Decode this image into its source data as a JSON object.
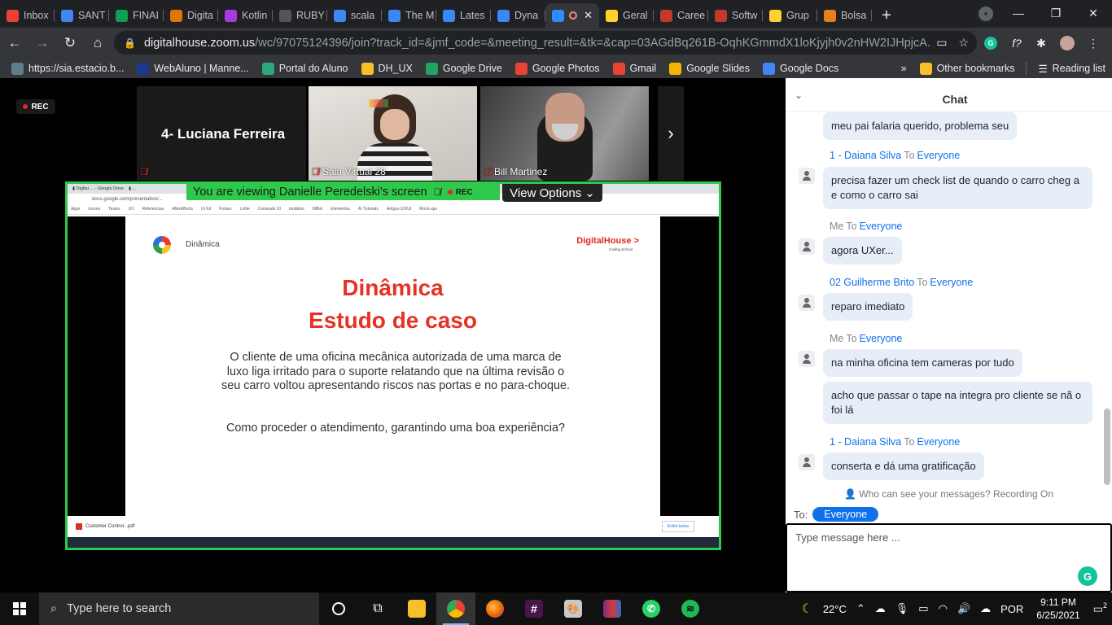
{
  "browser": {
    "tabs": [
      {
        "label": "Inbox",
        "icon": "gmail-icon",
        "color": "#ea4335"
      },
      {
        "label": "SANT",
        "icon": "docs-icon",
        "color": "#4285f4"
      },
      {
        "label": "FINAI",
        "icon": "sheets-icon",
        "color": "#0f9d58"
      },
      {
        "label": "Digita",
        "icon": "app-icon",
        "color": "#e37400"
      },
      {
        "label": "Kotlin",
        "icon": "kotlin-icon",
        "color": "#a83be0"
      },
      {
        "label": "RUBY",
        "icon": "ruby-icon",
        "color": "#555555"
      },
      {
        "label": "scala",
        "icon": "docs-icon",
        "color": "#4285f4"
      },
      {
        "label": "The M",
        "icon": "webflow-icon",
        "color": "#3b88f5"
      },
      {
        "label": "Lates",
        "icon": "webflow-icon",
        "color": "#3b88f5"
      },
      {
        "label": "Dyna",
        "icon": "webflow-icon",
        "color": "#3b88f5"
      },
      {
        "label": "",
        "icon": "zoom-icon",
        "color": "#2d8cff"
      },
      {
        "label": "Geral",
        "icon": "miro-icon",
        "color": "#ffd02f"
      },
      {
        "label": "Caree",
        "icon": "stack-icon",
        "color": "#c0392b"
      },
      {
        "label": "Softw",
        "icon": "stack-icon",
        "color": "#c0392b"
      },
      {
        "label": "Grup",
        "icon": "miro-icon",
        "color": "#ffd02f"
      },
      {
        "label": "Bolsa",
        "icon": "app-icon",
        "color": "#e67e22"
      }
    ],
    "url_host": "digitalhouse.zoom.us",
    "url_path": "/wc/97075124396/join?track_id=&jmf_code=&meeting_result=&tk=&cap=03AGdBq261B-OqhKGmmdX1loKjyjh0v2nHW2IJHpjcA...",
    "bookmarks": [
      {
        "label": "https://sia.estacio.b...",
        "color": "#607d8b"
      },
      {
        "label": "WebAluno | Manne...",
        "color": "#1a3a8f"
      },
      {
        "label": "Portal do Aluno",
        "color": "#2ea67a"
      },
      {
        "label": "DH_UX",
        "color": "#f6c02b"
      },
      {
        "label": "Google Drive",
        "color": "#1fa463"
      },
      {
        "label": "Google Photos",
        "color": "#ea4335"
      },
      {
        "label": "Gmail",
        "color": "#ea4335"
      },
      {
        "label": "Google Slides",
        "color": "#f4b400"
      },
      {
        "label": "Google Docs",
        "color": "#4285f4"
      }
    ],
    "other_bookmarks": "Other bookmarks",
    "reading_list": "Reading list",
    "overflow": "»"
  },
  "meeting": {
    "rec_label": "REC",
    "tiles": [
      {
        "name": "4- Luciana Ferreira"
      },
      {
        "name": "Sala Virtual 28"
      },
      {
        "name": "Bill Martinez"
      }
    ],
    "share_banner": "You are viewing Danielle Peredelski's screen",
    "view_options": "View Options"
  },
  "slide": {
    "header_small": "Dinâmica",
    "brand": "DigitalHouse >",
    "brand_sub": "Coding School",
    "title_line1": "Dinâmica",
    "title_line2": "Estudo de caso",
    "body": "O cliente de uma oficina mecânica autorizada de uma marca de luxo liga irritado para o suporte relatando que na última revisão o seu carro voltou apresentando riscos nas portas e no para-choque.",
    "question": "Como proceder o atendimento, garantindo uma boa experiência?",
    "inner_download": "Customer Control...pdf",
    "inner_download_btn": "Exibir todos"
  },
  "chat": {
    "title": "Chat",
    "messages": [
      {
        "sender": "",
        "to": "",
        "recipient": "",
        "text": "meu pai falaria querido, problema seu"
      },
      {
        "sender": "1 - Daiana Silva",
        "to": "To",
        "recipient": "Everyone",
        "text": "precisa fazer um check list de quando o carro cheg a e como o carro sai"
      },
      {
        "sender": "Me",
        "to": "To",
        "recipient": "Everyone",
        "text": "agora UXer..."
      },
      {
        "sender": "02 Guilherme Brito",
        "to": "To",
        "recipient": "Everyone",
        "text": "reparo imediato"
      },
      {
        "sender": "Me",
        "to": "To",
        "recipient": "Everyone",
        "text": "na minha oficina tem cameras por tudo"
      },
      {
        "sender": "",
        "to": "",
        "recipient": "",
        "text": "acho que passar o tape na integra pro cliente se nã o foi lá"
      },
      {
        "sender": "1 - Daiana Silva",
        "to": "To",
        "recipient": "Everyone",
        "text": "conserta e dá uma gratificação"
      }
    ],
    "who_can_see": "Who can see your messages? Recording On",
    "to_label": "To:",
    "to_value": "Everyone",
    "input_placeholder": "Type message here ..."
  },
  "taskbar": {
    "search_placeholder": "Type here to search",
    "temperature": "22°C",
    "language": "POR",
    "time": "9:11 PM",
    "date": "6/25/2021",
    "notifications": "2"
  }
}
